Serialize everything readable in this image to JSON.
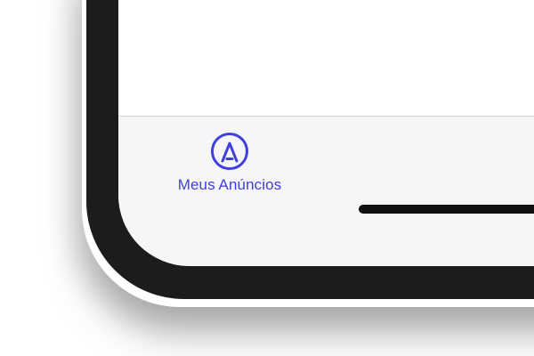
{
  "tab_bar": {
    "items": [
      {
        "label": "Meus Anúncios",
        "icon": "ad-circle-icon",
        "active": true
      }
    ]
  },
  "colors": {
    "accent": "#3f3fe0",
    "tab_bar_background": "#f6f6f8",
    "device_frame": "#1c1c1c",
    "home_indicator": "#111111"
  }
}
